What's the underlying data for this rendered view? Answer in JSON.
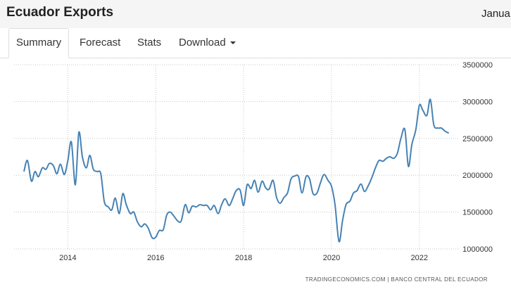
{
  "header": {
    "title": "Ecuador Exports",
    "date_partial": "Janua"
  },
  "tabs": [
    {
      "label": "Summary",
      "active": true
    },
    {
      "label": "Forecast",
      "active": false
    },
    {
      "label": "Stats",
      "active": false
    },
    {
      "label": "Download",
      "active": false,
      "dropdown": true
    }
  ],
  "chart_data": {
    "type": "line",
    "title": "",
    "xlabel": "",
    "ylabel": "",
    "line_color": "#4682b4",
    "grid": "dotted",
    "x_tick_labels": [
      "2014",
      "2016",
      "2018",
      "2020",
      "2022"
    ],
    "x_ticks": [
      2014,
      2016,
      2018,
      2020,
      2022
    ],
    "y_tick_labels": [
      "1000000",
      "1500000",
      "2000000",
      "2500000",
      "3000000",
      "3500000"
    ],
    "y_ticks": [
      1000000,
      1500000,
      2000000,
      2500000,
      3000000,
      3500000
    ],
    "xlim": [
      2013.0,
      2022.9
    ],
    "ylim": [
      1000000,
      3500000
    ],
    "series": [
      {
        "values": [
          [
            2013.0,
            2050000
          ],
          [
            2013.08,
            2200000
          ],
          [
            2013.17,
            1920000
          ],
          [
            2013.25,
            2050000
          ],
          [
            2013.33,
            1980000
          ],
          [
            2013.42,
            2100000
          ],
          [
            2013.5,
            2080000
          ],
          [
            2013.58,
            2160000
          ],
          [
            2013.67,
            2130000
          ],
          [
            2013.75,
            2020000
          ],
          [
            2013.83,
            2150000
          ],
          [
            2013.92,
            2010000
          ],
          [
            2014.0,
            2200000
          ],
          [
            2014.08,
            2450000
          ],
          [
            2014.17,
            1870000
          ],
          [
            2014.25,
            2580000
          ],
          [
            2014.33,
            2250000
          ],
          [
            2014.42,
            2100000
          ],
          [
            2014.5,
            2270000
          ],
          [
            2014.58,
            2080000
          ],
          [
            2014.67,
            2050000
          ],
          [
            2014.75,
            2020000
          ],
          [
            2014.83,
            1640000
          ],
          [
            2014.92,
            1570000
          ],
          [
            2015.0,
            1530000
          ],
          [
            2015.08,
            1690000
          ],
          [
            2015.17,
            1480000
          ],
          [
            2015.25,
            1750000
          ],
          [
            2015.33,
            1600000
          ],
          [
            2015.42,
            1480000
          ],
          [
            2015.5,
            1500000
          ],
          [
            2015.58,
            1370000
          ],
          [
            2015.67,
            1300000
          ],
          [
            2015.75,
            1340000
          ],
          [
            2015.83,
            1280000
          ],
          [
            2015.92,
            1150000
          ],
          [
            2016.0,
            1160000
          ],
          [
            2016.08,
            1250000
          ],
          [
            2016.17,
            1260000
          ],
          [
            2016.25,
            1460000
          ],
          [
            2016.33,
            1500000
          ],
          [
            2016.42,
            1440000
          ],
          [
            2016.5,
            1380000
          ],
          [
            2016.58,
            1380000
          ],
          [
            2016.67,
            1600000
          ],
          [
            2016.75,
            1490000
          ],
          [
            2016.83,
            1580000
          ],
          [
            2016.92,
            1570000
          ],
          [
            2017.0,
            1600000
          ],
          [
            2017.08,
            1590000
          ],
          [
            2017.17,
            1590000
          ],
          [
            2017.25,
            1530000
          ],
          [
            2017.33,
            1590000
          ],
          [
            2017.42,
            1480000
          ],
          [
            2017.5,
            1600000
          ],
          [
            2017.58,
            1680000
          ],
          [
            2017.67,
            1590000
          ],
          [
            2017.75,
            1680000
          ],
          [
            2017.83,
            1790000
          ],
          [
            2017.92,
            1800000
          ],
          [
            2018.0,
            1590000
          ],
          [
            2018.08,
            1870000
          ],
          [
            2018.17,
            1820000
          ],
          [
            2018.25,
            1930000
          ],
          [
            2018.33,
            1770000
          ],
          [
            2018.42,
            1920000
          ],
          [
            2018.5,
            1830000
          ],
          [
            2018.58,
            1810000
          ],
          [
            2018.67,
            1930000
          ],
          [
            2018.75,
            1700000
          ],
          [
            2018.83,
            1620000
          ],
          [
            2018.92,
            1700000
          ],
          [
            2019.0,
            1760000
          ],
          [
            2019.08,
            1950000
          ],
          [
            2019.17,
            1990000
          ],
          [
            2019.25,
            1980000
          ],
          [
            2019.33,
            1760000
          ],
          [
            2019.42,
            1980000
          ],
          [
            2019.5,
            1950000
          ],
          [
            2019.58,
            1750000
          ],
          [
            2019.67,
            1760000
          ],
          [
            2019.75,
            1900000
          ],
          [
            2019.83,
            2010000
          ],
          [
            2019.92,
            1930000
          ],
          [
            2020.0,
            1850000
          ],
          [
            2020.08,
            1600000
          ],
          [
            2020.17,
            1100000
          ],
          [
            2020.25,
            1380000
          ],
          [
            2020.33,
            1600000
          ],
          [
            2020.42,
            1650000
          ],
          [
            2020.5,
            1760000
          ],
          [
            2020.58,
            1790000
          ],
          [
            2020.67,
            1880000
          ],
          [
            2020.75,
            1780000
          ],
          [
            2020.83,
            1850000
          ],
          [
            2020.92,
            1970000
          ],
          [
            2021.0,
            2100000
          ],
          [
            2021.08,
            2200000
          ],
          [
            2021.17,
            2190000
          ],
          [
            2021.25,
            2230000
          ],
          [
            2021.33,
            2250000
          ],
          [
            2021.42,
            2230000
          ],
          [
            2021.5,
            2300000
          ],
          [
            2021.58,
            2500000
          ],
          [
            2021.67,
            2620000
          ],
          [
            2021.75,
            2120000
          ],
          [
            2021.83,
            2420000
          ],
          [
            2021.92,
            2620000
          ],
          [
            2022.0,
            2950000
          ],
          [
            2022.08,
            2880000
          ],
          [
            2022.17,
            2810000
          ],
          [
            2022.25,
            3030000
          ],
          [
            2022.33,
            2680000
          ],
          [
            2022.42,
            2640000
          ],
          [
            2022.5,
            2640000
          ],
          [
            2022.58,
            2600000
          ],
          [
            2022.67,
            2570000
          ]
        ]
      }
    ]
  },
  "credit": "TRADINGECONOMICS.COM  |  BANCO CENTRAL DEL ECUADOR"
}
